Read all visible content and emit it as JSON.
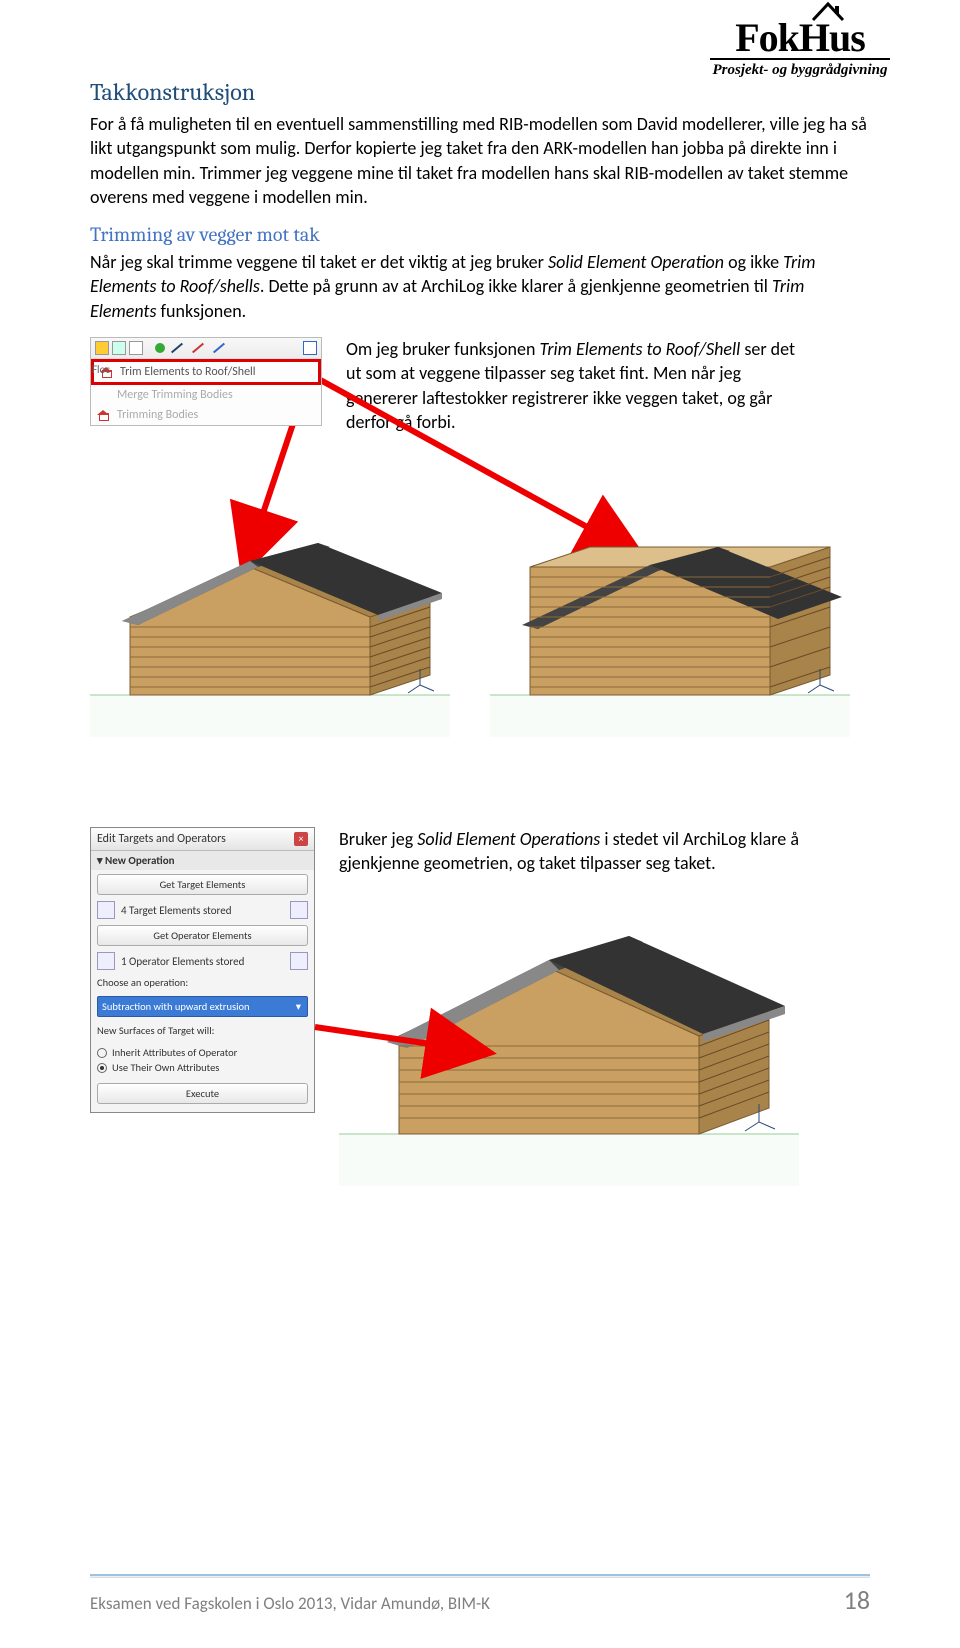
{
  "logo": {
    "main": "FokHus",
    "sub": "Prosjekt- og byggrådgivning"
  },
  "section1": {
    "title": "Takkonstruksjon",
    "para": "For å få muligheten til en eventuell sammenstilling med RIB-modellen som David modellerer, ville jeg ha så likt utgangspunkt som mulig. Derfor kopierte jeg taket fra den ARK-modellen han jobba på direkte inn i modellen min. Trimmer jeg veggene mine til taket fra modellen hans skal RIB-modellen av taket stemme overens med veggene i modellen min."
  },
  "section2": {
    "title": "Trimming av vegger mot tak",
    "para1a": "Når jeg skal trimme veggene til taket er det viktig at jeg bruker ",
    "para1_em1": "Solid Element Operation",
    "para1b": " og ikke ",
    "para1_em2": "Trim Elements to Roof/shells",
    "para1c": ". Dette på grunn av at ArchiLog ikke klarer å gjenkjenne geometrien til ",
    "para1_em3": "Trim Elements",
    "para1d": " funksjonen."
  },
  "menu": {
    "floor_label": "Floc",
    "item1": "Trim Elements to Roof/Shell",
    "item2": "Merge Trimming Bodies",
    "item3": "Trimming Bodies"
  },
  "side_text1a": "Om jeg bruker funksjonen ",
  "side_text1_em": "Trim Elements to Roof/Shell",
  "side_text1b": " ser det ut som at veggene tilpasser seg taket fint. Men når jeg genererer laftestokker registrerer ikke veggen taket, og går derfor gå forbi.",
  "dialog": {
    "title": "Edit Targets and Operators",
    "new_op": "New Operation",
    "btn_target": "Get Target Elements",
    "target_status": "4 Target Elements stored",
    "btn_operator": "Get Operator Elements",
    "operator_status": "1 Operator Elements stored",
    "choose": "Choose an operation:",
    "selected": "Subtraction with upward extrusion",
    "surfaces": "New Surfaces of Target will:",
    "radio1": "Inherit Attributes of Operator",
    "radio2": "Use Their Own Attributes",
    "execute": "Execute"
  },
  "side_text2a": "Bruker jeg ",
  "side_text2_em": "Solid Element Operations",
  "side_text2b": " i stedet vil ArchiLog klare å gjenkjenne geometrien, og taket tilpasser seg taket.",
  "footer": {
    "text": "Eksamen ved Fagskolen i Oslo 2013, Vidar Amundø, BIM-K",
    "page": "18"
  }
}
